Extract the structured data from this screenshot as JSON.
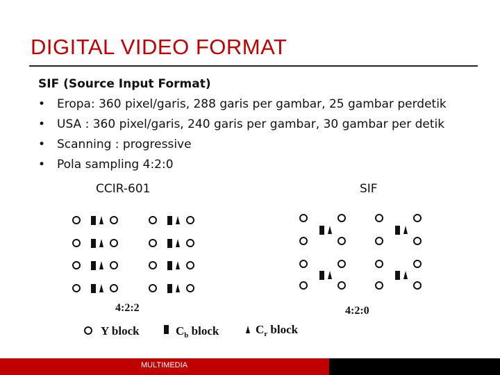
{
  "title": "DIGITAL VIDEO FORMAT",
  "subtitle": "SIF (Source Input Format)",
  "bullets": [
    {
      "marker": "•",
      "text": "Eropa: 360 pixel/garis, 288 garis per gambar, 25 gambar perdetik"
    },
    {
      "marker": "•",
      "text": "USA : 360 pixel/garis, 240 garis per gambar, 30 gambar per detik"
    },
    {
      "marker": "•",
      "text": "Scanning : progressive"
    },
    {
      "marker": "•",
      "text": "Pola sampling 4:2:0"
    }
  ],
  "labels": {
    "left": "CCIR-601",
    "right": "SIF"
  },
  "figure": {
    "left_caption": "4:2:2",
    "right_caption": "4:2:0",
    "legend": {
      "y": "Y block",
      "cb_main": "C",
      "cb_sub": "b",
      "cb_rest": " block",
      "cr_main": "C",
      "cr_sub": "r",
      "cr_rest": " block"
    }
  },
  "footer": {
    "text": "MULTIMEDIA"
  },
  "colors": {
    "accent": "#c00000",
    "footer_dark": "#000000"
  }
}
